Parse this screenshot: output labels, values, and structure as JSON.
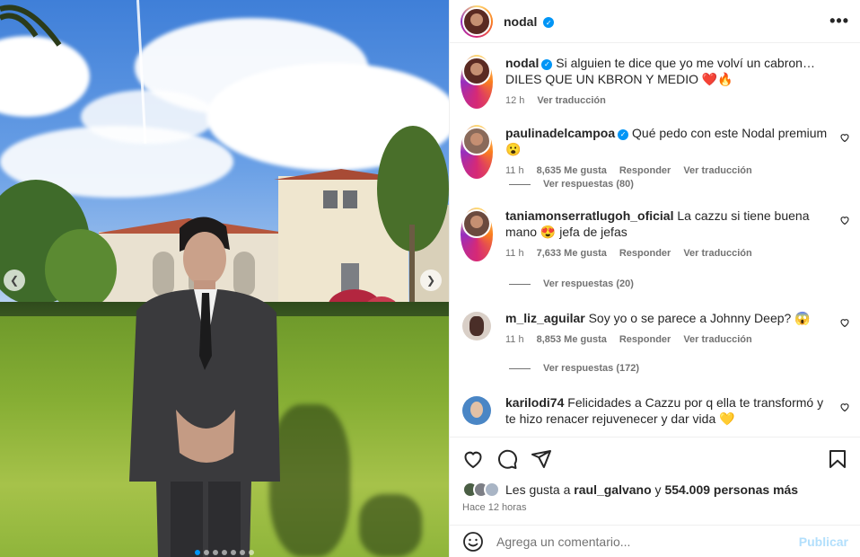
{
  "post": {
    "username": "nodal",
    "verified": true,
    "more_icon": "•••"
  },
  "caption": {
    "username": "nodal",
    "line1": "Si alguien te dice que yo me volví un cabron…",
    "line2": "DILES QUE UN KBRON Y MEDIO ❤️🔥",
    "time": "12 h",
    "translate": "Ver traducción"
  },
  "comments": [
    {
      "username": "paulinadelcampoa",
      "verified": true,
      "text": "Qué pedo con este Nodal premium 😮",
      "time": "11 h",
      "likes": "8,635 Me gusta",
      "reply": "Responder",
      "translate": "Ver traducción",
      "replies": "Ver respuestas (80)",
      "avatar_color": "#8a6a5a",
      "ring": true
    },
    {
      "username": "taniamonserratlugoh_oficial",
      "verified": false,
      "text": "La cazzu si tiene buena mano 😍 jefa de jefas",
      "time": "11 h",
      "likes": "7,633 Me gusta",
      "reply": "Responder",
      "translate": "Ver traducción",
      "replies": "Ver respuestas (20)",
      "avatar_color": "#6b4a3e",
      "ring": true
    },
    {
      "username": "m_liz_aguilar",
      "verified": false,
      "text": "Soy yo o se parece a Johnny Deep? 😱",
      "time": "11 h",
      "likes": "8,853 Me gusta",
      "reply": "Responder",
      "translate": "Ver traducción",
      "replies": "Ver respuestas (172)",
      "avatar_color": "#d9cfc7",
      "ring": false
    },
    {
      "username": "karilodi74",
      "verified": false,
      "text": "Felicidades a Cazzu por q ella te transformó y te hizo renacer rejuvenecer y dar vida 💛",
      "avatar_color": "#4a86c5",
      "ring": false
    }
  ],
  "likes": {
    "prefix": "Les gusta a",
    "user": "raul_galvano",
    "connector": "y",
    "others": "554.009 personas más"
  },
  "date": "Hace 12 horas",
  "composer": {
    "placeholder": "Agrega un comentario...",
    "publish": "Publicar"
  },
  "colors": {
    "accent": "#0095f6",
    "publish_disabled": "#b2dffc",
    "secondary_text": "#737373"
  },
  "icons": [
    "heart-icon",
    "comment-icon",
    "share-icon",
    "bookmark-icon",
    "emoji-icon",
    "verified-icon",
    "more-icon"
  ]
}
